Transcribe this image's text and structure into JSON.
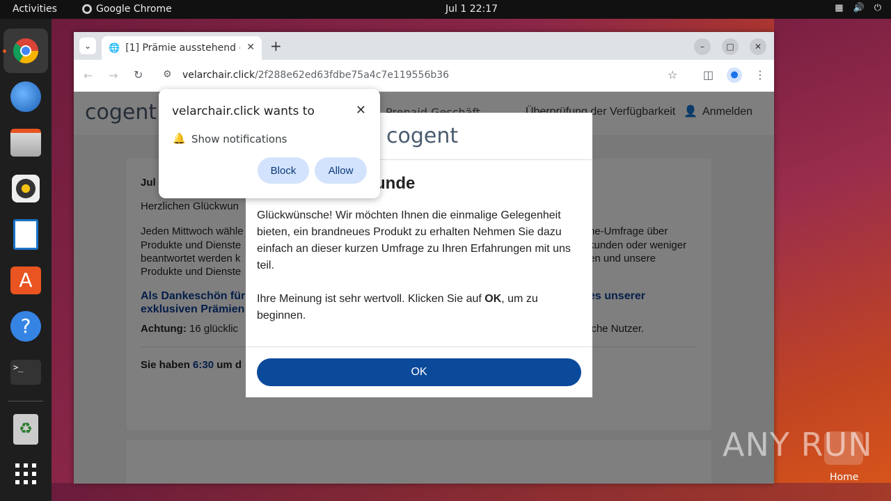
{
  "topbar": {
    "activities": "Activities",
    "app_name": "Google Chrome",
    "clock": "Jul 1  22:17"
  },
  "browser": {
    "tab_title": "[1] Prämie ausstehend - (",
    "url_host": "velarchair.click",
    "url_path": "/2f288e62ed63fdbe75a4c7e119556b36"
  },
  "site": {
    "logo": "cogent",
    "nav_partial": "Prepaid   Geschäft",
    "nav_check": "Überprüfung der Verfügbarkeit",
    "nav_login": "Anmelden",
    "date_partial": "Jul",
    "congrats_partial": "Herzlichen Glückwun",
    "para1": [
      "Jeden Mittwoch wähle",
      "Produkte und Dienste",
      "beantwortet werden k",
      "Produkte und Dienste"
    ],
    "para1_right": [
      "ne-Umfrage über",
      "kunden oder weniger",
      "en und unsere"
    ],
    "thanks_left": [
      "Als Dankeschön für",
      "exklusiven Prämien"
    ],
    "thanks_right": "es unserer",
    "attention_label": "Achtung:",
    "attention_text": " 16 glücklic",
    "attention_right": "iche Nutzer.",
    "timer_prefix": "Sie haben ",
    "timer_value": "6:30",
    "timer_suffix": " um d"
  },
  "modal": {
    "logo": "cogent",
    "title_partial": "unde",
    "body1": "Glückwünsche! Wir möchten Ihnen die einmalige Gelegenheit bieten, ein brandneues Produkt zu erhalten Nehmen Sie dazu einfach an dieser kurzen Umfrage zu Ihren Erfahrungen mit uns teil.",
    "body2_prefix": "Ihre Meinung ist sehr wertvoll. Klicken Sie auf ",
    "body2_bold": "OK",
    "body2_suffix": ", um zu beginnen.",
    "ok_label": "OK"
  },
  "notification": {
    "title": "velarchair.click wants to",
    "permission": "Show notifications",
    "block_label": "Block",
    "allow_label": "Allow"
  },
  "desktop": {
    "watermark": "ANY RUN",
    "home_label": "Home"
  },
  "colors": {
    "ok_button": "#0b4a9b",
    "link_blue": "#0b3d91",
    "chip_blue": "#d3e3fd"
  }
}
